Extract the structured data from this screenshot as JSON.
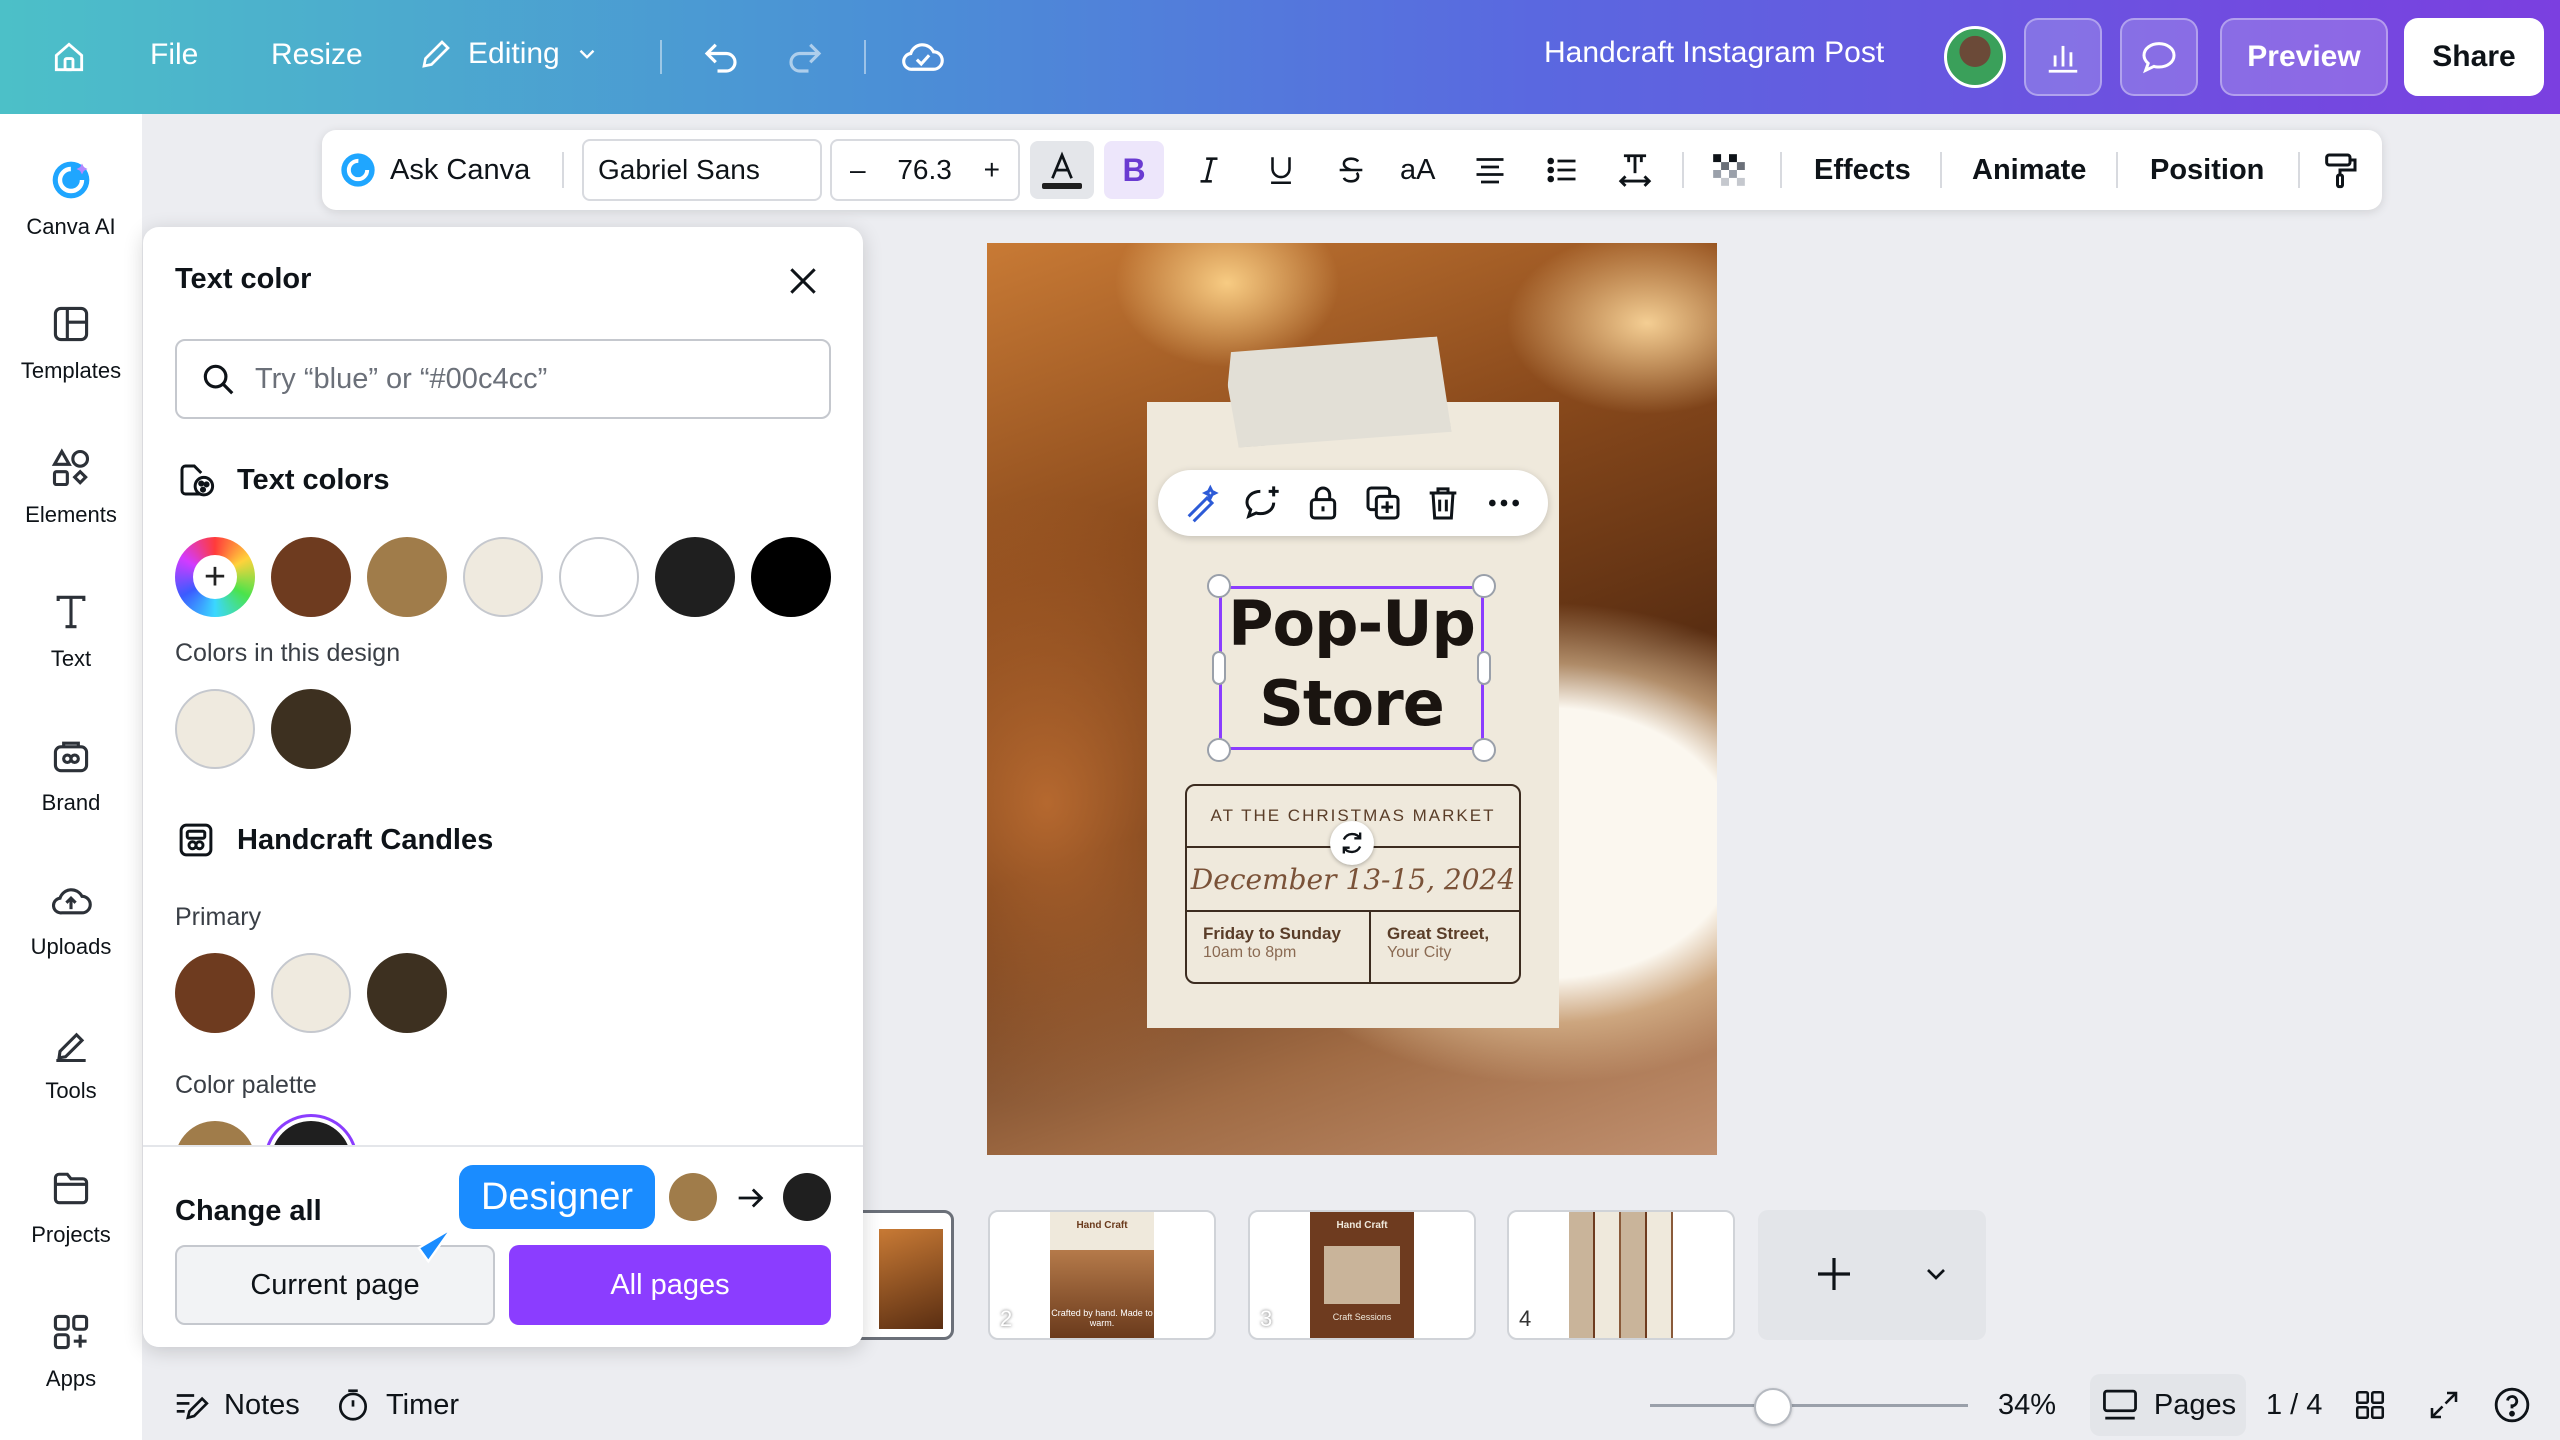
{
  "topbar": {
    "file": "File",
    "resize": "Resize",
    "editing": "Editing",
    "title": "Handcraft Instagram Post",
    "preview": "Preview",
    "share": "Share"
  },
  "rail": [
    {
      "label": "Canva AI",
      "icon": "canva-ai-icon"
    },
    {
      "label": "Templates",
      "icon": "templates-icon"
    },
    {
      "label": "Elements",
      "icon": "elements-icon"
    },
    {
      "label": "Text",
      "icon": "text-icon"
    },
    {
      "label": "Brand",
      "icon": "brand-icon"
    },
    {
      "label": "Uploads",
      "icon": "uploads-icon"
    },
    {
      "label": "Tools",
      "icon": "tools-icon"
    },
    {
      "label": "Projects",
      "icon": "projects-icon"
    },
    {
      "label": "Apps",
      "icon": "apps-icon"
    }
  ],
  "toolbar": {
    "ask_canva": "Ask Canva",
    "font": "Gabriel Sans",
    "font_size": "76.3",
    "minus": "–",
    "plus": "+",
    "bold": "B",
    "case": "aA",
    "effects": "Effects",
    "animate": "Animate",
    "position": "Position"
  },
  "panel": {
    "title": "Text color",
    "search_placeholder": "Try “blue” or “#00c4cc”",
    "text_colors_heading": "Text colors",
    "text_colors": [
      "#6e3b1f",
      "#a07c4a",
      "#efeadf",
      "#ffffff",
      "#1f1f1f",
      "#000000"
    ],
    "design_colors_heading": "Colors in this design",
    "design_colors": [
      "#efeadf",
      "#3d3020"
    ],
    "brand_kit_heading": "Handcraft Candles",
    "primary_heading": "Primary",
    "primary_colors": [
      "#6e3b1f",
      "#efeadf",
      "#3d3020"
    ],
    "palette_heading": "Color palette",
    "palette_colors": [
      "#a07c4a",
      "#1f1f1f"
    ],
    "change_all": "Change all",
    "change_from": "#a07c4a",
    "change_to": "#1f1f1f",
    "designer_tag": "Designer",
    "current_page": "Current page",
    "all_pages": "All pages"
  },
  "design": {
    "headline_1": "Pop-Up",
    "headline_2": "Store",
    "event": "AT THE CHRISTMAS MARKET",
    "date": "December 13-15, 2024",
    "days": "Friday to Sunday",
    "hours": "10am to 8pm",
    "street": "Great Street,",
    "city": "Your City"
  },
  "pages": {
    "thumbs": [
      {
        "num": "2",
        "caption": "Crafted by hand. Made to warm.",
        "label": "Hand Craft"
      },
      {
        "num": "3",
        "caption": "Craft Sessions",
        "label": "Hand Craft"
      },
      {
        "num": "4"
      }
    ]
  },
  "bottom": {
    "notes": "Notes",
    "timer": "Timer",
    "zoom": "34%",
    "zoom_level": 0.34,
    "pages": "Pages",
    "page_counter": "1 / 4"
  }
}
